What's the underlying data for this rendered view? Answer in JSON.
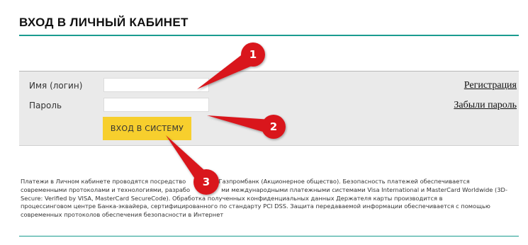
{
  "page": {
    "title": "ВХОД В ЛИЧНЫЙ КАБИНЕТ",
    "accent_color": "#1a9c8f"
  },
  "login_form": {
    "login_label": "Имя (логин)",
    "login_value": "",
    "password_label": "Пароль",
    "password_value": "",
    "submit_label": "ВХОД В СИСТЕМУ",
    "submit_color": "#f7cf2d",
    "panel_color": "#eaeaea"
  },
  "links": {
    "register": "Регистрация",
    "forgot_password": "Забыли пароль"
  },
  "disclaimer": {
    "lines": [
      {
        "before": "Платежи в Личном кабинете проводятся посредство",
        "after": "са Газпромбанк (Акционерное общество). Безопасность платежей обеспечивается"
      },
      {
        "before": "современными протоколами и технологиями, разрабо",
        "after": "ми международными платежными системами Visa International и MasterCard Worldwide (3D-"
      },
      {
        "before": "Secure: Verified by VISA, MasterCard SecureCode). Обработка полученных конфиденциальных данных Держателя карты производится в",
        "after": ""
      },
      {
        "before": "процессинговом центре Банка-эквайера, сертифицированного по стандарту PCI DSS. Защита передаваемой информации обеспечивается с помощью",
        "after": ""
      },
      {
        "before": "современных протоколов обеспечения безопасности в Интернет",
        "after": ""
      }
    ]
  },
  "callouts": {
    "color": "#d9141b",
    "items": [
      {
        "number": "1"
      },
      {
        "number": "2"
      },
      {
        "number": "3"
      }
    ]
  }
}
